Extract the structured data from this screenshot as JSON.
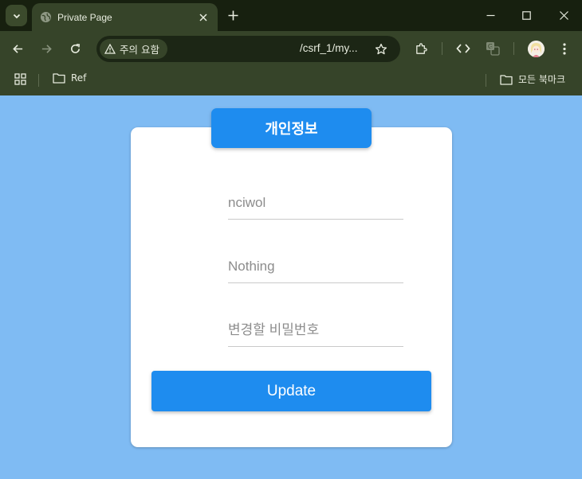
{
  "browser": {
    "tab_title": "Private Page",
    "security_chip": "주의 요함",
    "url": "/csrf_1/my...",
    "bookmarks": {
      "folder": "Ref",
      "all_bookmarks": "모든 북마크"
    }
  },
  "page": {
    "title": "개인정보",
    "fields": {
      "username_placeholder": "nciwol",
      "info_placeholder": "Nothing",
      "password_placeholder": "변경할 비밀번호"
    },
    "update_label": "Update"
  },
  "colors": {
    "page_background": "#7fbbf3",
    "accent": "#1e8cef",
    "chrome_dark": "#17200f",
    "chrome_toolbar": "#364429"
  }
}
